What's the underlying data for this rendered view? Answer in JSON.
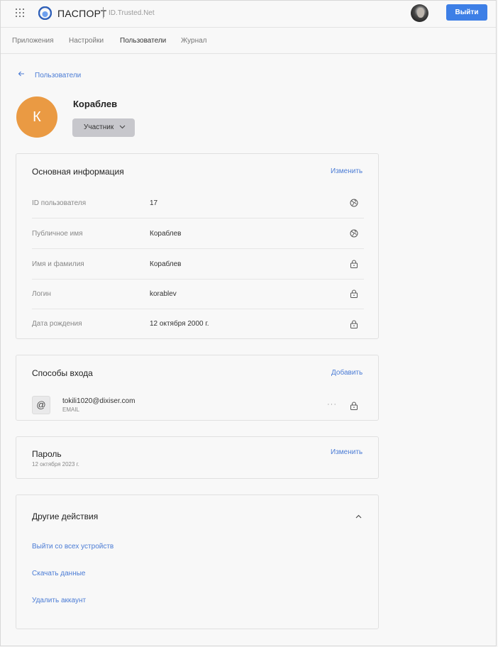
{
  "header": {
    "brand": "ПАСПОРТ",
    "brand_sub": "ID.Trusted.Net",
    "logout_label": "Выйти"
  },
  "nav": {
    "items": [
      {
        "label": "Приложения"
      },
      {
        "label": "Настройки"
      },
      {
        "label": "Пользователи"
      },
      {
        "label": "Журнал"
      }
    ]
  },
  "breadcrumb": {
    "back_label": "Пользователи"
  },
  "profile": {
    "initial": "К",
    "name": "Кораблев",
    "role": "Участник"
  },
  "basic_info": {
    "title": "Основная информация",
    "action": "Изменить",
    "rows": [
      {
        "label": "ID пользователя",
        "value": "17",
        "icon": "globe-icon"
      },
      {
        "label": "Публичное имя",
        "value": "Кораблев",
        "icon": "globe-icon"
      },
      {
        "label": "Имя и фамилия",
        "value": "Кораблев",
        "icon": "lock-icon"
      },
      {
        "label": "Логин",
        "value": "korablev",
        "icon": "lock-icon"
      },
      {
        "label": "Дата рождения",
        "value": "12 октября 2000 г.",
        "icon": "lock-icon"
      }
    ]
  },
  "login_methods": {
    "title": "Способы входа",
    "action": "Добавить",
    "items": [
      {
        "icon_glyph": "@",
        "value": "tokili1020@dixiser.com",
        "type": "EMAIL"
      }
    ]
  },
  "password": {
    "title": "Пароль",
    "date": "12 октября 2023 г.",
    "action": "Изменить"
  },
  "other_actions": {
    "title": "Другие действия",
    "links": [
      {
        "label": "Выйти со всех устройств"
      },
      {
        "label": "Скачать данные"
      },
      {
        "label": "Удалить аккаунт"
      }
    ]
  },
  "colors": {
    "accent": "#3d7fe6",
    "link": "#4b7cd5",
    "avatar": "#ea9a43",
    "role_badge": "#c7c7cc"
  }
}
